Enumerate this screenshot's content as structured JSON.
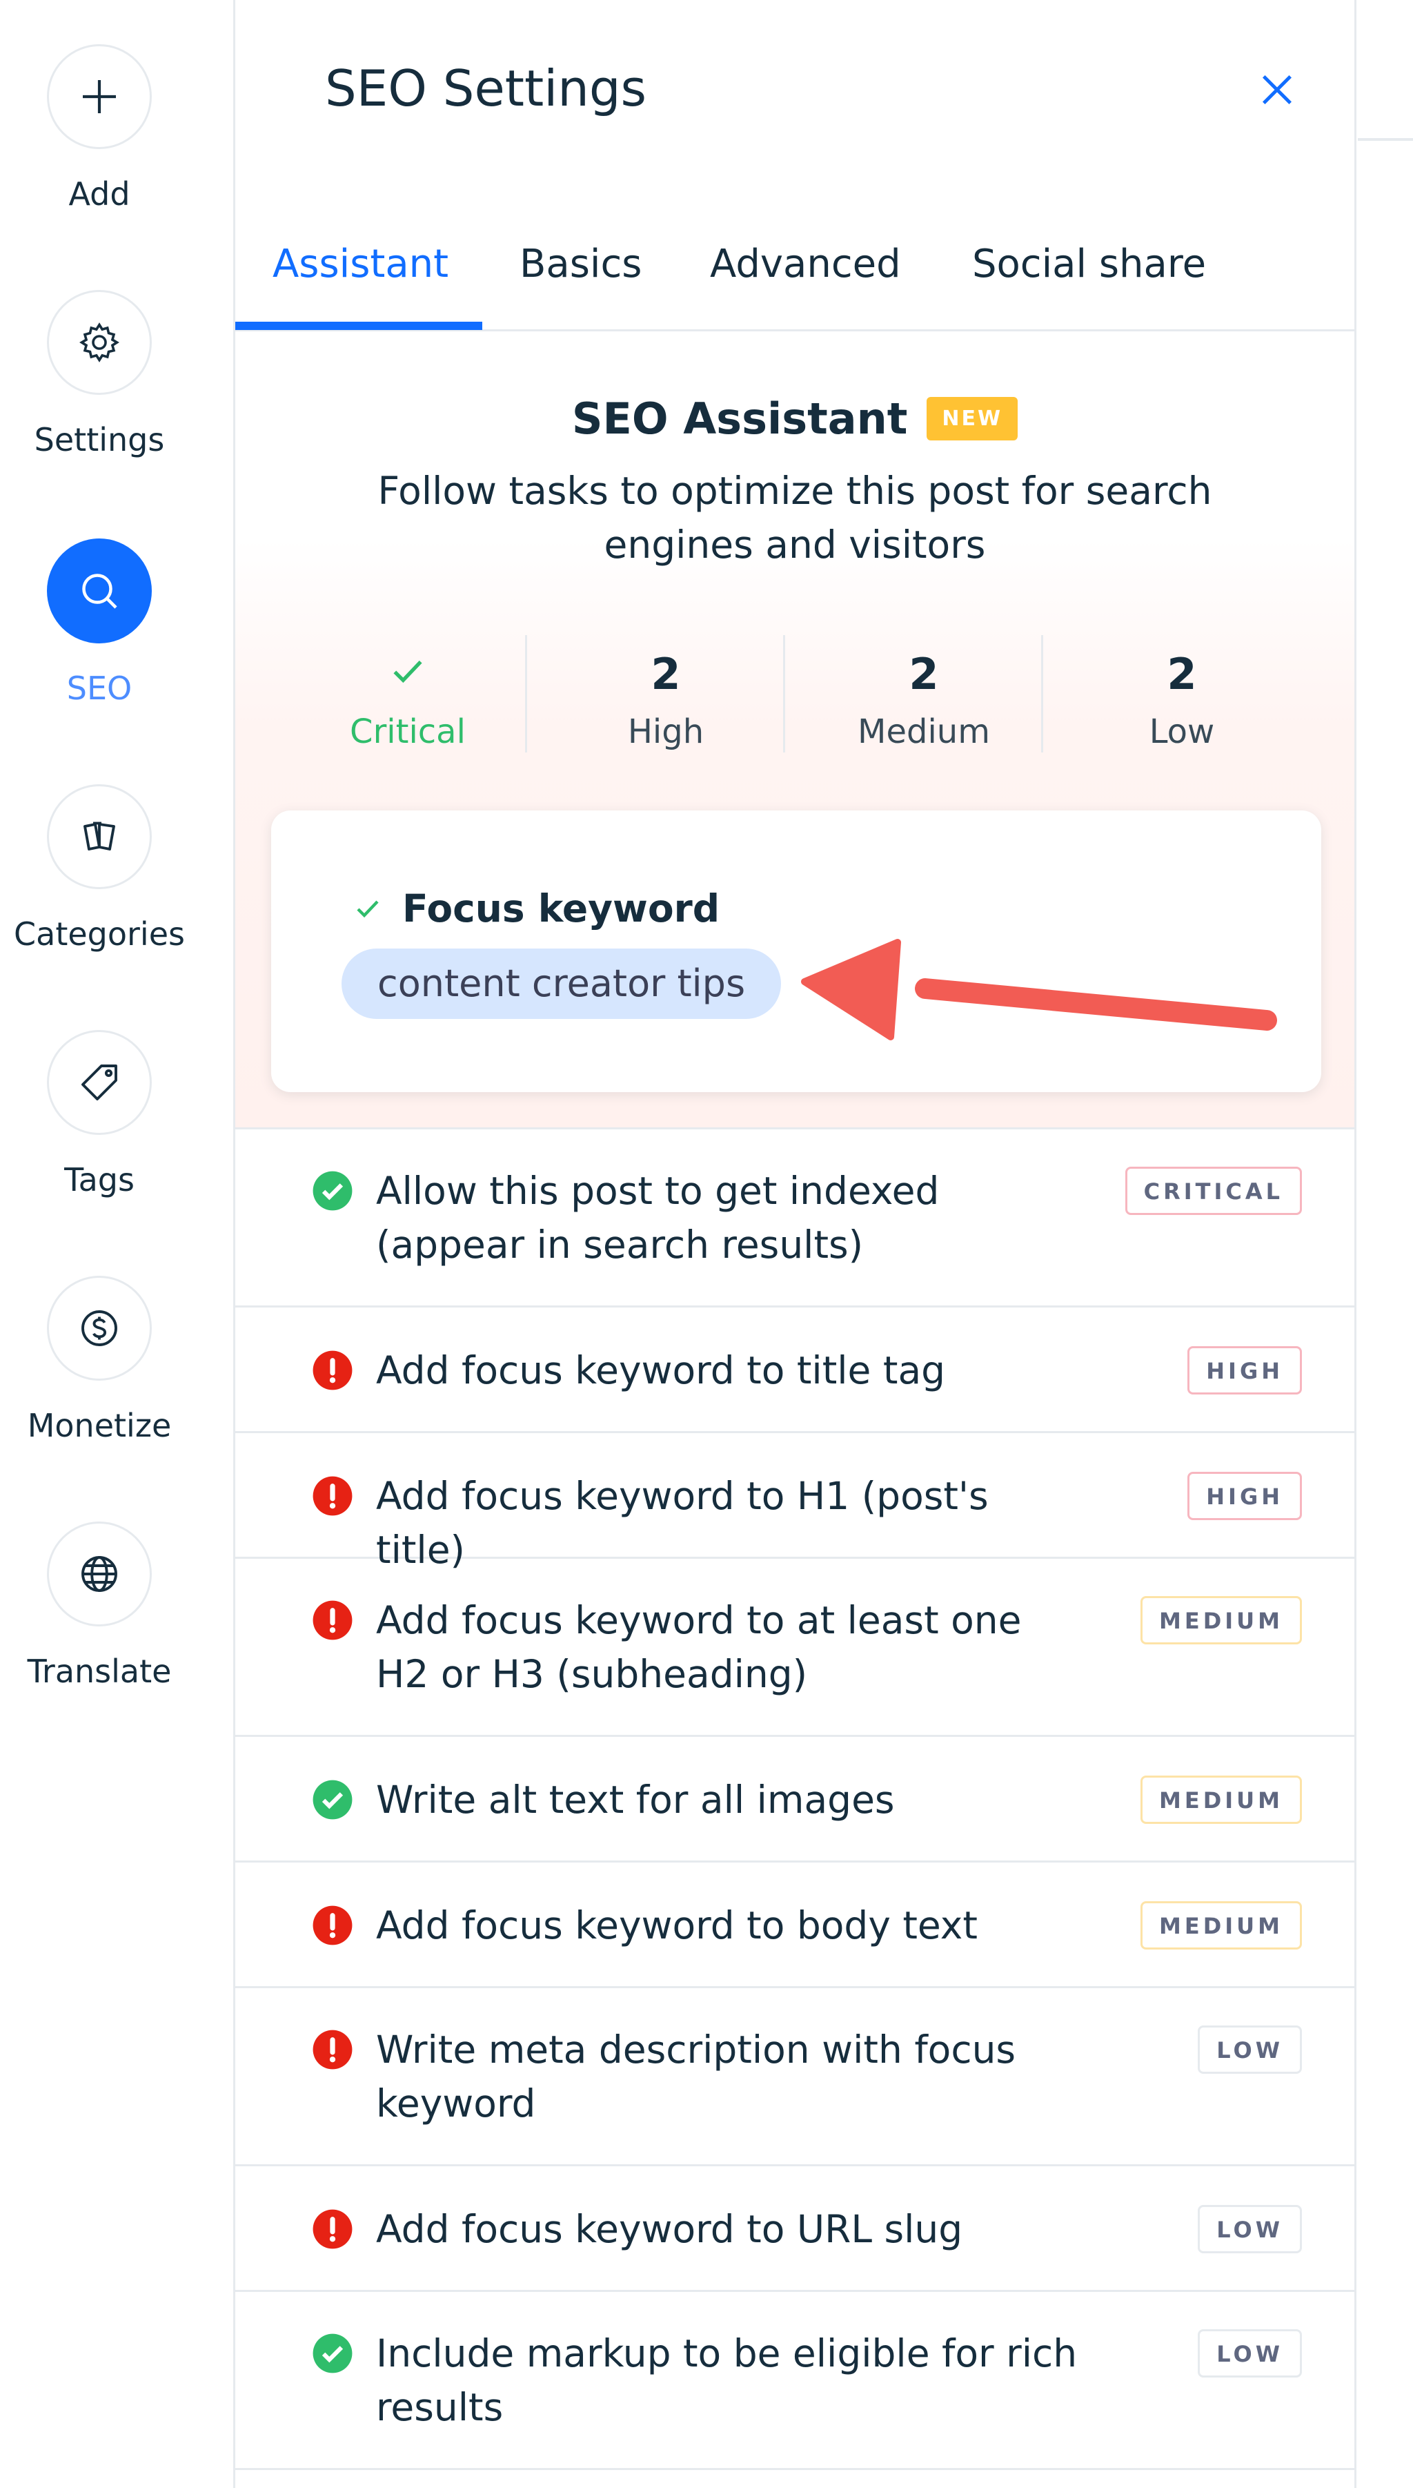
{
  "sidebar": {
    "items": [
      {
        "label": "Add",
        "icon": "plus-icon",
        "active": false
      },
      {
        "label": "Settings",
        "icon": "gear-icon",
        "active": false
      },
      {
        "label": "SEO",
        "icon": "search-icon",
        "active": true
      },
      {
        "label": "Categories",
        "icon": "categories-icon",
        "active": false
      },
      {
        "label": "Tags",
        "icon": "tag-icon",
        "active": false
      },
      {
        "label": "Monetize",
        "icon": "dollar-icon",
        "active": false
      },
      {
        "label": "Translate",
        "icon": "globe-icon",
        "active": false
      }
    ]
  },
  "panel": {
    "title": "SEO Settings",
    "close_icon": "close-icon"
  },
  "tabs": [
    {
      "label": "Assistant",
      "active": true
    },
    {
      "label": "Basics",
      "active": false
    },
    {
      "label": "Advanced",
      "active": false
    },
    {
      "label": "Social share",
      "active": false
    }
  ],
  "assistant": {
    "title": "SEO Assistant",
    "badge": "NEW",
    "subtitle": "Follow tasks to optimize this post for search engines and visitors",
    "counts": [
      {
        "value": "",
        "label": "Critical",
        "done": true
      },
      {
        "value": "2",
        "label": "High",
        "done": false
      },
      {
        "value": "2",
        "label": "Medium",
        "done": false
      },
      {
        "value": "2",
        "label": "Low",
        "done": false
      }
    ],
    "focus_keyword": {
      "label": "Focus keyword",
      "value": "content creator tips"
    }
  },
  "tasks": [
    {
      "text": "Allow this post to get indexed (appear in search results)",
      "status": "done",
      "priority": "CRITICAL"
    },
    {
      "text": "Add focus keyword to title tag",
      "status": "error",
      "priority": "HIGH"
    },
    {
      "text": "Add focus keyword to H1 (post's title)",
      "status": "error",
      "priority": "HIGH"
    },
    {
      "text": "Add focus keyword to at least one H2 or H3 (subheading)",
      "status": "error",
      "priority": "MEDIUM"
    },
    {
      "text": "Write alt text for all images",
      "status": "done",
      "priority": "MEDIUM"
    },
    {
      "text": "Add focus keyword to body text",
      "status": "error",
      "priority": "MEDIUM"
    },
    {
      "text": "Write meta description with focus keyword",
      "status": "error",
      "priority": "LOW"
    },
    {
      "text": "Add focus keyword to URL slug",
      "status": "error",
      "priority": "LOW"
    },
    {
      "text": "Include markup to be eligible for rich results",
      "status": "done",
      "priority": "LOW"
    }
  ],
  "colors": {
    "accent": "#116dff",
    "success": "#2fbd6b",
    "error": "#e62214",
    "new_badge": "#ffc233",
    "keyword_chip": "#d6e6fe",
    "arrow": "#f25c54"
  }
}
